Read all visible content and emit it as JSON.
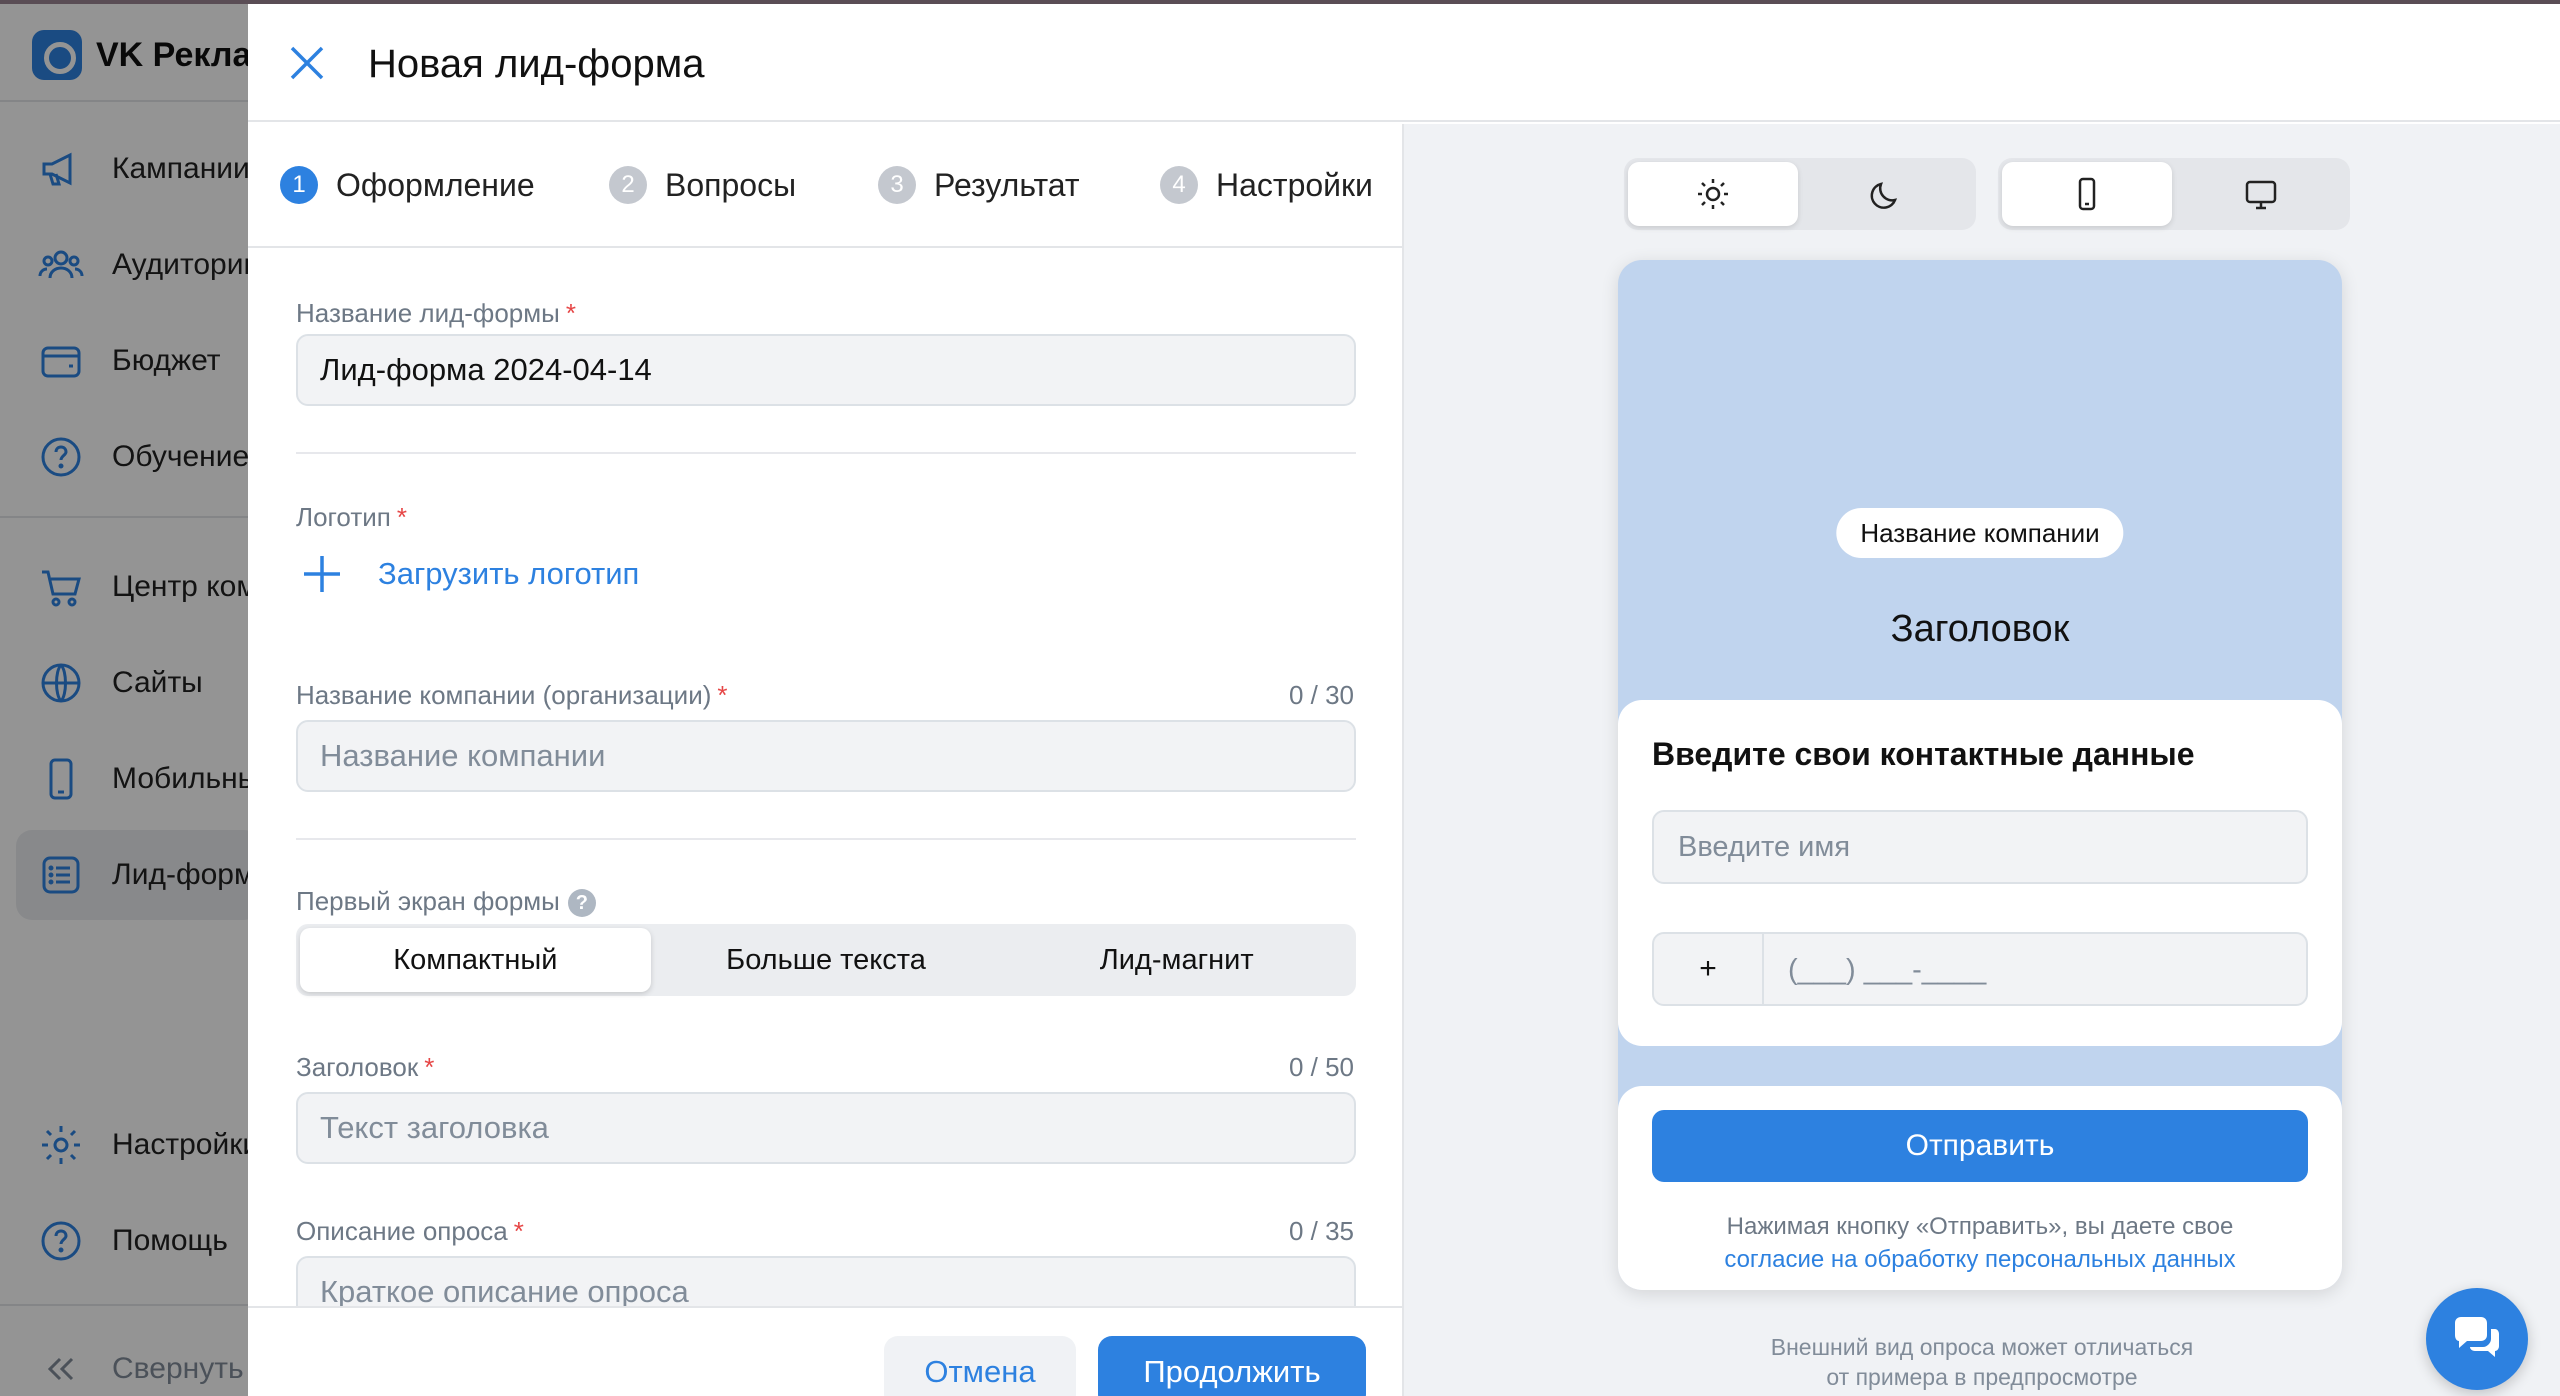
{
  "app": {
    "logo_text": "VK Рекла"
  },
  "sidebar": {
    "items": [
      {
        "label": "Кампании",
        "icon": "megaphone-icon"
      },
      {
        "label": "Аудитории",
        "icon": "users-icon"
      },
      {
        "label": "Бюджет",
        "icon": "wallet-icon"
      },
      {
        "label": "Обучение",
        "icon": "help-circle-icon"
      },
      {
        "label": "Центр коммерции",
        "icon": "cart-icon"
      },
      {
        "label": "Сайты",
        "icon": "globe-icon"
      },
      {
        "label": "Мобильные приложения",
        "icon": "smartphone-icon"
      },
      {
        "label": "Лид-формы",
        "icon": "list-icon"
      },
      {
        "label": "Настройки",
        "icon": "gear-icon"
      },
      {
        "label": "Помощь",
        "icon": "help-circle-icon"
      },
      {
        "label": "Свернуть",
        "icon": "chevrons-left-icon"
      }
    ]
  },
  "modal": {
    "title": "Новая лид-форма",
    "steps": [
      {
        "num": "1",
        "label": "Оформление",
        "active": true
      },
      {
        "num": "2",
        "label": "Вопросы"
      },
      {
        "num": "3",
        "label": "Результат"
      },
      {
        "num": "4",
        "label": "Настройки"
      }
    ]
  },
  "form": {
    "form_name": {
      "label": "Название лид-формы",
      "value": "Лид-форма 2024-04-14"
    },
    "logo": {
      "label": "Логотип",
      "upload_label": "Загрузить логотип"
    },
    "company": {
      "label": "Название компании (организации)",
      "counter": "0 / 30",
      "placeholder": "Название компании"
    },
    "first_screen": {
      "label": "Первый экран формы",
      "help": "?",
      "options": [
        "Компактный",
        "Больше текста",
        "Лид-магнит"
      ],
      "selected": "Компактный"
    },
    "headline": {
      "label": "Заголовок",
      "counter": "0 / 50",
      "placeholder": "Текст заголовка"
    },
    "description": {
      "label": "Описание опроса",
      "counter": "0 / 35",
      "placeholder": "Краткое описание опроса"
    },
    "required_mark": "*",
    "cancel": "Отмена",
    "continue": "Продолжить"
  },
  "preview": {
    "theme": {
      "selected": "light",
      "options": [
        "sun-icon",
        "moon-icon"
      ]
    },
    "device": {
      "selected": "mobile",
      "options": [
        "smartphone-icon",
        "monitor-icon"
      ]
    },
    "company_pill": "Название компании",
    "title": "Заголовок",
    "contact_title": "Введите свои контактные данные",
    "name_placeholder": "Введите имя",
    "phone_prefix": "+",
    "phone_mask": "(___) ___-____",
    "submit": "Отправить",
    "consent_text": "Нажимая кнопку «Отправить», вы даете свое",
    "consent_link": "согласие на обработку персональных данных",
    "note_line1": "Внешний вид опроса может отличаться",
    "note_line2": "от примера в предпросмотре"
  },
  "colors": {
    "accent": "#2d81e0",
    "required": "#e64646",
    "preview_bg": "#c0d4ee"
  }
}
